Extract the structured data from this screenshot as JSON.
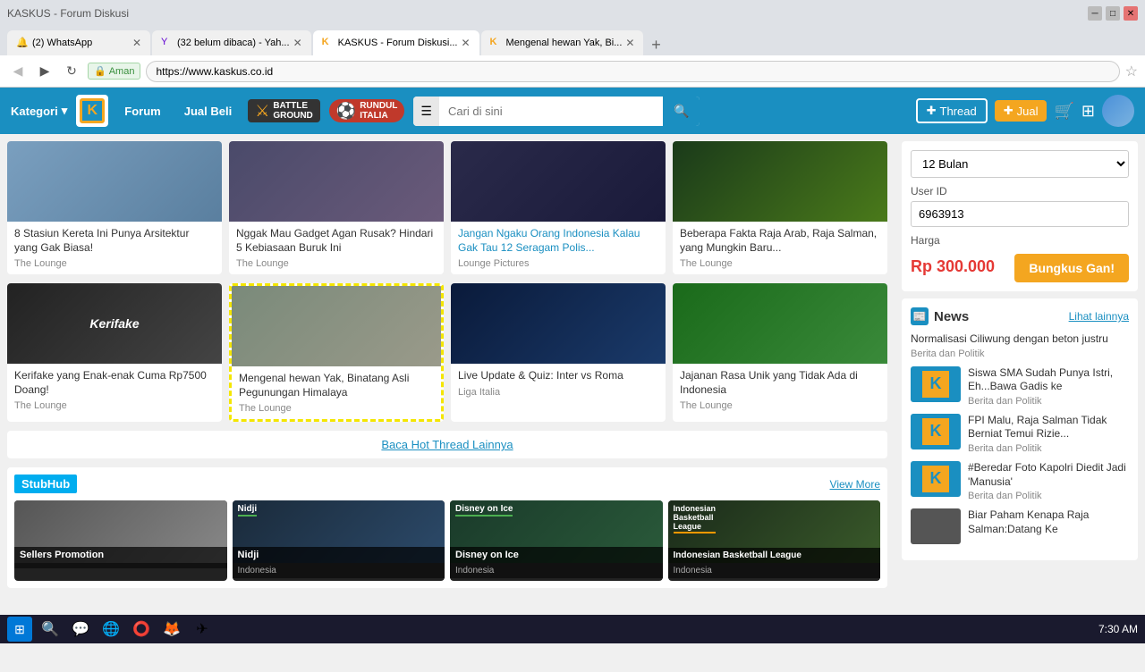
{
  "browser": {
    "tabs": [
      {
        "id": 1,
        "favicon": "🔔",
        "title": "(2) WhatsApp",
        "active": false,
        "color": "#25d366"
      },
      {
        "id": 2,
        "favicon": "📧",
        "title": "(32 belum dibaca) - Yah...",
        "active": false,
        "color": "#6001d2"
      },
      {
        "id": 3,
        "favicon": "K",
        "title": "KASKUS - Forum Diskusi...",
        "active": true,
        "color": "#f4a620"
      },
      {
        "id": 4,
        "favicon": "K",
        "title": "Mengenal hewan Yak, Bi...",
        "active": false,
        "color": "#f4a620"
      }
    ],
    "url": "https://www.kaskus.co.id",
    "secure_label": "Aman"
  },
  "header": {
    "kategori_label": "Kategori",
    "forum_label": "Forum",
    "jual_beli_label": "Jual Beli",
    "battle_ground_line1": "BATTLE",
    "battle_ground_line2": "GROUND",
    "search_placeholder": "Cari di sini",
    "thread_label": "Thread",
    "jual_label": "Jual"
  },
  "articles_row1": [
    {
      "title": "8 Stasiun Kereta Ini Punya Arsitektur yang Gak Biasa!",
      "category": "The Lounge",
      "title_color": "normal",
      "img_class": "img-arch"
    },
    {
      "title": "Nggak Mau Gadget Agan Rusak? Hindari 5 Kebiasaan Buruk Ini",
      "category": "The Lounge",
      "title_color": "normal",
      "img_class": "img-gadget"
    },
    {
      "title": "Jangan Ngaku Orang Indonesia Kalau Gak Tau 12 Seragam Polis...",
      "category": "Lounge Pictures",
      "title_color": "blue",
      "img_class": "img-police"
    },
    {
      "title": "Beberapa Fakta Raja Arab, Raja Salman, yang Mungkin Baru...",
      "category": "The Lounge",
      "title_color": "normal",
      "img_class": "img-arab"
    }
  ],
  "articles_row2": [
    {
      "title": "Kerifake yang Enak-enak Cuma Rp7500 Doang!",
      "category": "The Lounge",
      "title_color": "normal",
      "img_class": "img-keri",
      "highlighted": false
    },
    {
      "title": "Mengenal hewan Yak, Binatang Asli Pegunungan Himalaya",
      "category": "The Lounge",
      "title_color": "normal",
      "img_class": "img-yak",
      "highlighted": true
    },
    {
      "title": "Live Update & Quiz: Inter vs Roma",
      "category": "Liga Italia",
      "title_color": "normal",
      "img_class": "img-live",
      "highlighted": false
    },
    {
      "title": "Jajanan Rasa Unik yang Tidak Ada di Indonesia",
      "category": "The Lounge",
      "title_color": "normal",
      "img_class": "img-jajan",
      "highlighted": false
    }
  ],
  "hot_thread_link": "Baca Hot Thread Lainnya",
  "stubhub": {
    "logo": "StubHub",
    "view_more": "View More",
    "events": [
      {
        "name": "Sellers Promotion",
        "badge": "",
        "footer": "",
        "img_class": "img-sellers",
        "badge_color": "green"
      },
      {
        "name": "Nidji",
        "badge": "Nidji",
        "footer": "Indonesia",
        "img_class": "img-nidji",
        "badge_color": "green"
      },
      {
        "name": "Disney on Ice",
        "badge": "Disney on Ice",
        "footer": "Indonesia",
        "img_class": "img-disney",
        "badge_color": "green"
      },
      {
        "name": "Indonesian Basketball League",
        "badge": "Indonesian Basketball League",
        "footer": "Indonesia",
        "img_class": "img-ibl",
        "badge_color": "orange"
      }
    ]
  },
  "sidebar": {
    "subscription": {
      "select_options": [
        "12 Bulan"
      ],
      "selected": "12 Bulan",
      "user_id_label": "User ID",
      "user_id_value": "6963913",
      "harga_label": "Harga",
      "harga_value": "Rp 300.000",
      "btn_label": "Bungkus Gan!"
    },
    "news": {
      "title": "News",
      "lihat_label": "Lihat lainnya",
      "items": [
        {
          "headline": "Normalisasi Ciliwung dengan beton justru",
          "category": "Berita dan Politik"
        },
        {
          "headline": "Siswa SMA Sudah Punya Istri, Eh...Bawa Gadis ke",
          "category": "Berita dan Politik"
        },
        {
          "headline": "FPI Malu, Raja Salman Tidak Berniat Temui Rizie...",
          "category": "Berita dan Politik"
        },
        {
          "headline": "#Beredar Foto Kapolri Diedit Jadi 'Manusia'",
          "category": "Berita dan Politik"
        },
        {
          "headline": "Biar Paham Kenapa Raja Salman:Datang Ke",
          "category": ""
        }
      ]
    }
  },
  "time": "7:30 AM"
}
